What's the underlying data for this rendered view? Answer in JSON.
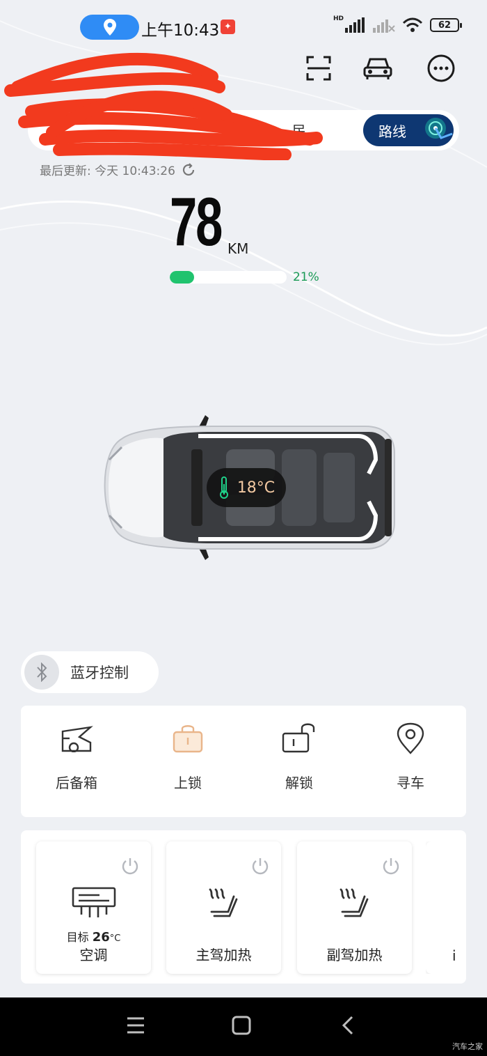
{
  "status_bar": {
    "time": "上午10:43",
    "network": "HD",
    "battery": "62"
  },
  "header": {
    "vehicle_name_redacted": "",
    "scan_icon": "scan-icon",
    "car_icon": "car-icon",
    "more_icon": "more-icon"
  },
  "location": {
    "address": "…民…",
    "route_label": "路线"
  },
  "status": {
    "last_updated": "最后更新: 今天 10:43:26",
    "range_value": "78",
    "range_unit": "KM",
    "battery_fraction": 0.21,
    "battery_text": "21%",
    "cabin_temp": "18°C"
  },
  "bluetooth": {
    "label": "蓝牙控制"
  },
  "quick_actions": [
    {
      "label": "后备箱",
      "icon": "trunk-icon"
    },
    {
      "label": "上锁",
      "icon": "lock-icon"
    },
    {
      "label": "解锁",
      "icon": "unlock-icon"
    },
    {
      "label": "寻车",
      "icon": "find-car-icon"
    }
  ],
  "controls": [
    {
      "name": "空调",
      "sub_prefix": "目标",
      "sub_value": "26",
      "sub_unit": "°C",
      "icon": "air-conditioner-icon"
    },
    {
      "name": "主驾加热",
      "icon": "seat-heat-icon"
    },
    {
      "name": "副驾加热",
      "icon": "seat-heat-icon"
    },
    {
      "name": "i",
      "icon": ""
    }
  ],
  "colors": {
    "route_button": "#0e3772",
    "battery_green": "#20c36e",
    "location_pill": "#2f8cf5"
  },
  "watermark": "汽车之家"
}
